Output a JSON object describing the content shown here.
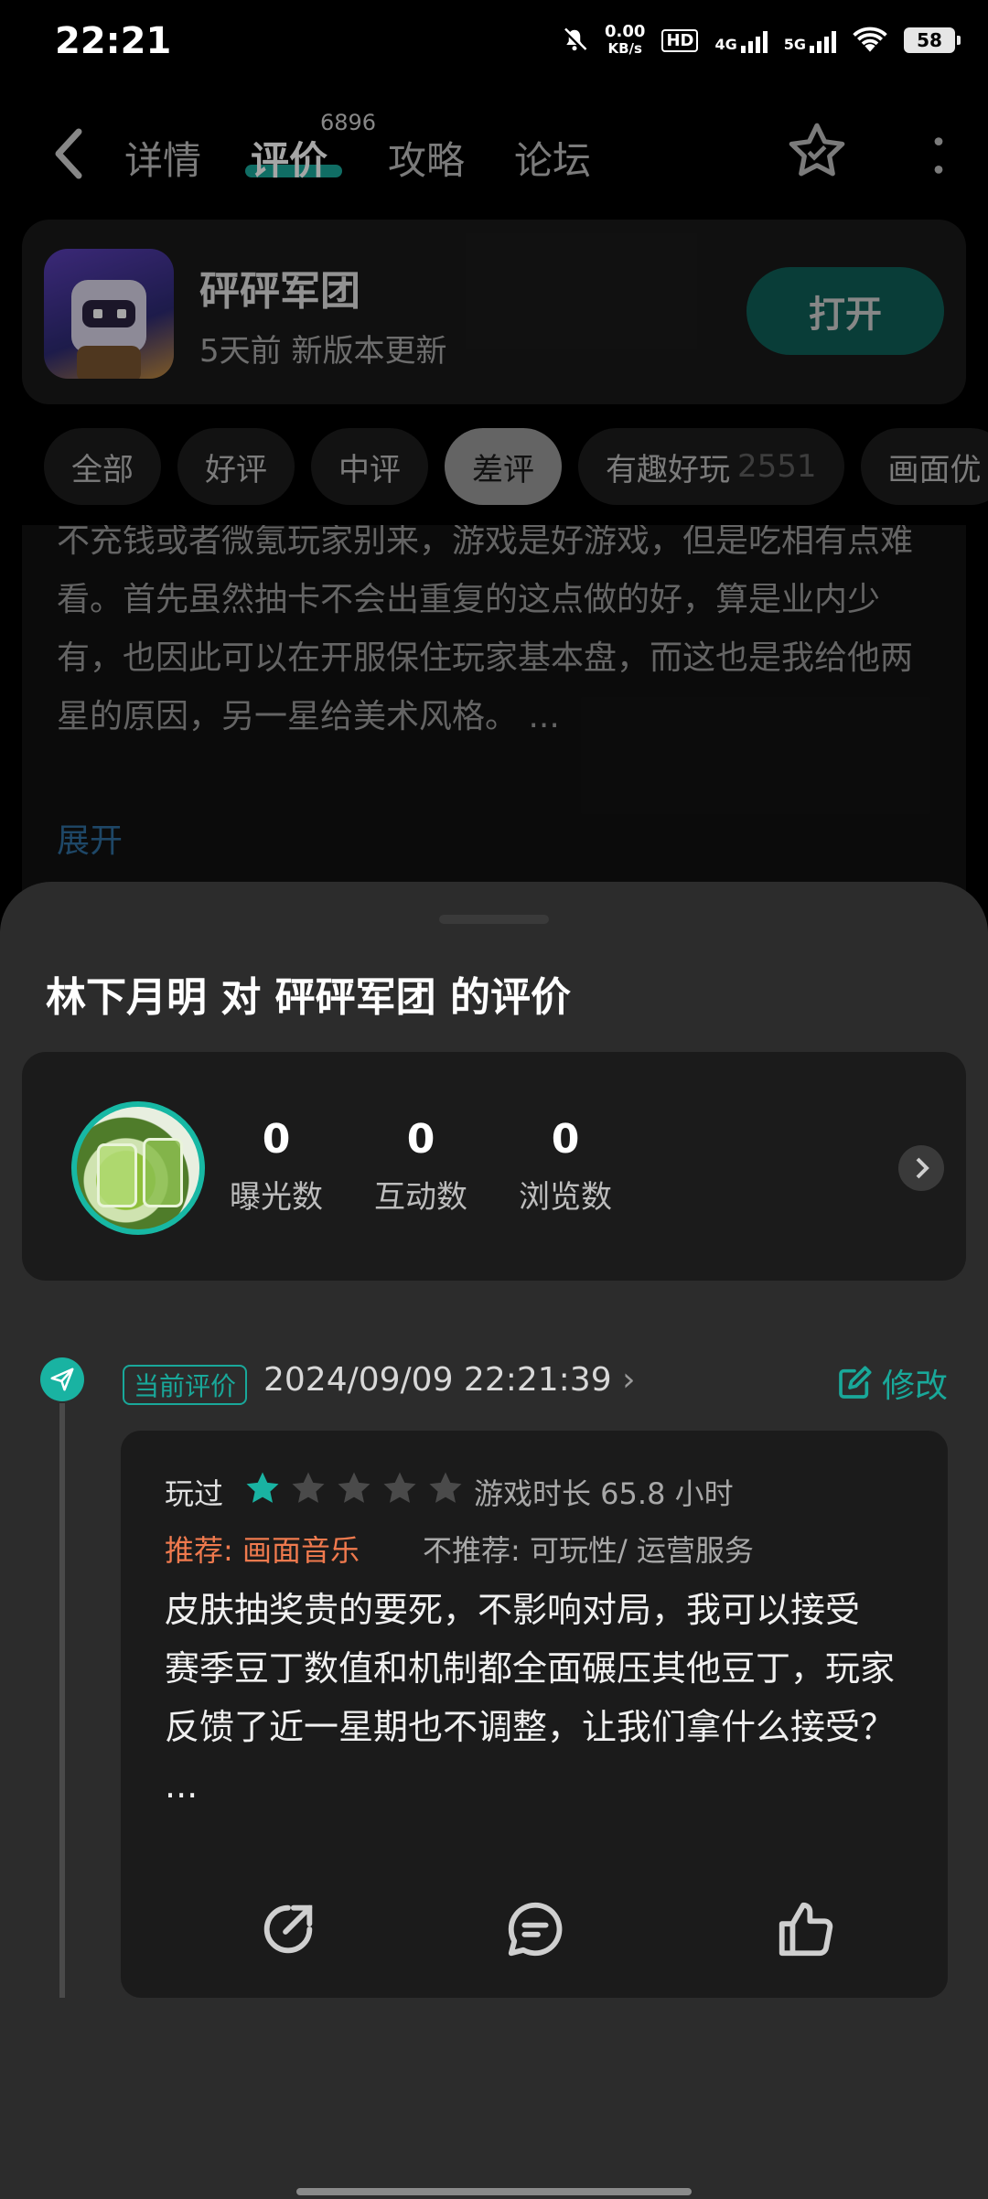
{
  "status_bar": {
    "time": "22:21",
    "net_speed_value": "0.00",
    "net_speed_unit": "KB/s",
    "hd": "HD",
    "sig1": "4G",
    "sig2": "5G",
    "battery": "58"
  },
  "nav": {
    "tabs": [
      {
        "label": "详情"
      },
      {
        "label": "评价"
      },
      {
        "label": "攻略"
      },
      {
        "label": "论坛"
      }
    ],
    "active_tab": "评价",
    "review_count": "6896"
  },
  "app": {
    "name": "砰砰军团",
    "subtitle": "5天前 新版本更新",
    "open_label": "打开"
  },
  "filters": [
    {
      "label": "全部"
    },
    {
      "label": "好评"
    },
    {
      "label": "中评"
    },
    {
      "label": "差评",
      "selected": true
    },
    {
      "label": "有趣好玩",
      "count": "2551"
    },
    {
      "label": "画面优"
    }
  ],
  "bg_review": {
    "text": "不充钱或者微氪玩家别来，游戏是好游戏，但是吃相有点难看。首先虽然抽卡不会出重复的这点做的好，算是业内少有，也因此可以在开服保住玩家基本盘，而这也是我给他两星的原因，另一星给美术风格。 ...",
    "expand": "展开"
  },
  "sheet": {
    "title": "林下月明 对 砰砰军团 的评价",
    "stats": [
      {
        "num": "0",
        "label": "曝光数"
      },
      {
        "num": "0",
        "label": "互动数"
      },
      {
        "num": "0",
        "label": "浏览数"
      }
    ],
    "current_badge": "当前评价",
    "date": "2024/09/09 22:21:39",
    "edit_label": "修改",
    "review": {
      "played": "玩过",
      "rating": 1,
      "max_rating": 5,
      "playtime": "游戏时长 65.8 小时",
      "recommend": "推荐: 画面音乐",
      "not_recommend": "不推荐: 可玩性/ 运营服务",
      "body": "皮肤抽奖贵的要死，不影响对局，我可以接受\n赛季豆丁数值和机制都全面碾压其他豆丁，玩家反馈了近一星期也不调整，让我们拿什么接受？ ..."
    }
  },
  "colors": {
    "accent": "#19a89a",
    "recommend": "#f07a4e"
  }
}
